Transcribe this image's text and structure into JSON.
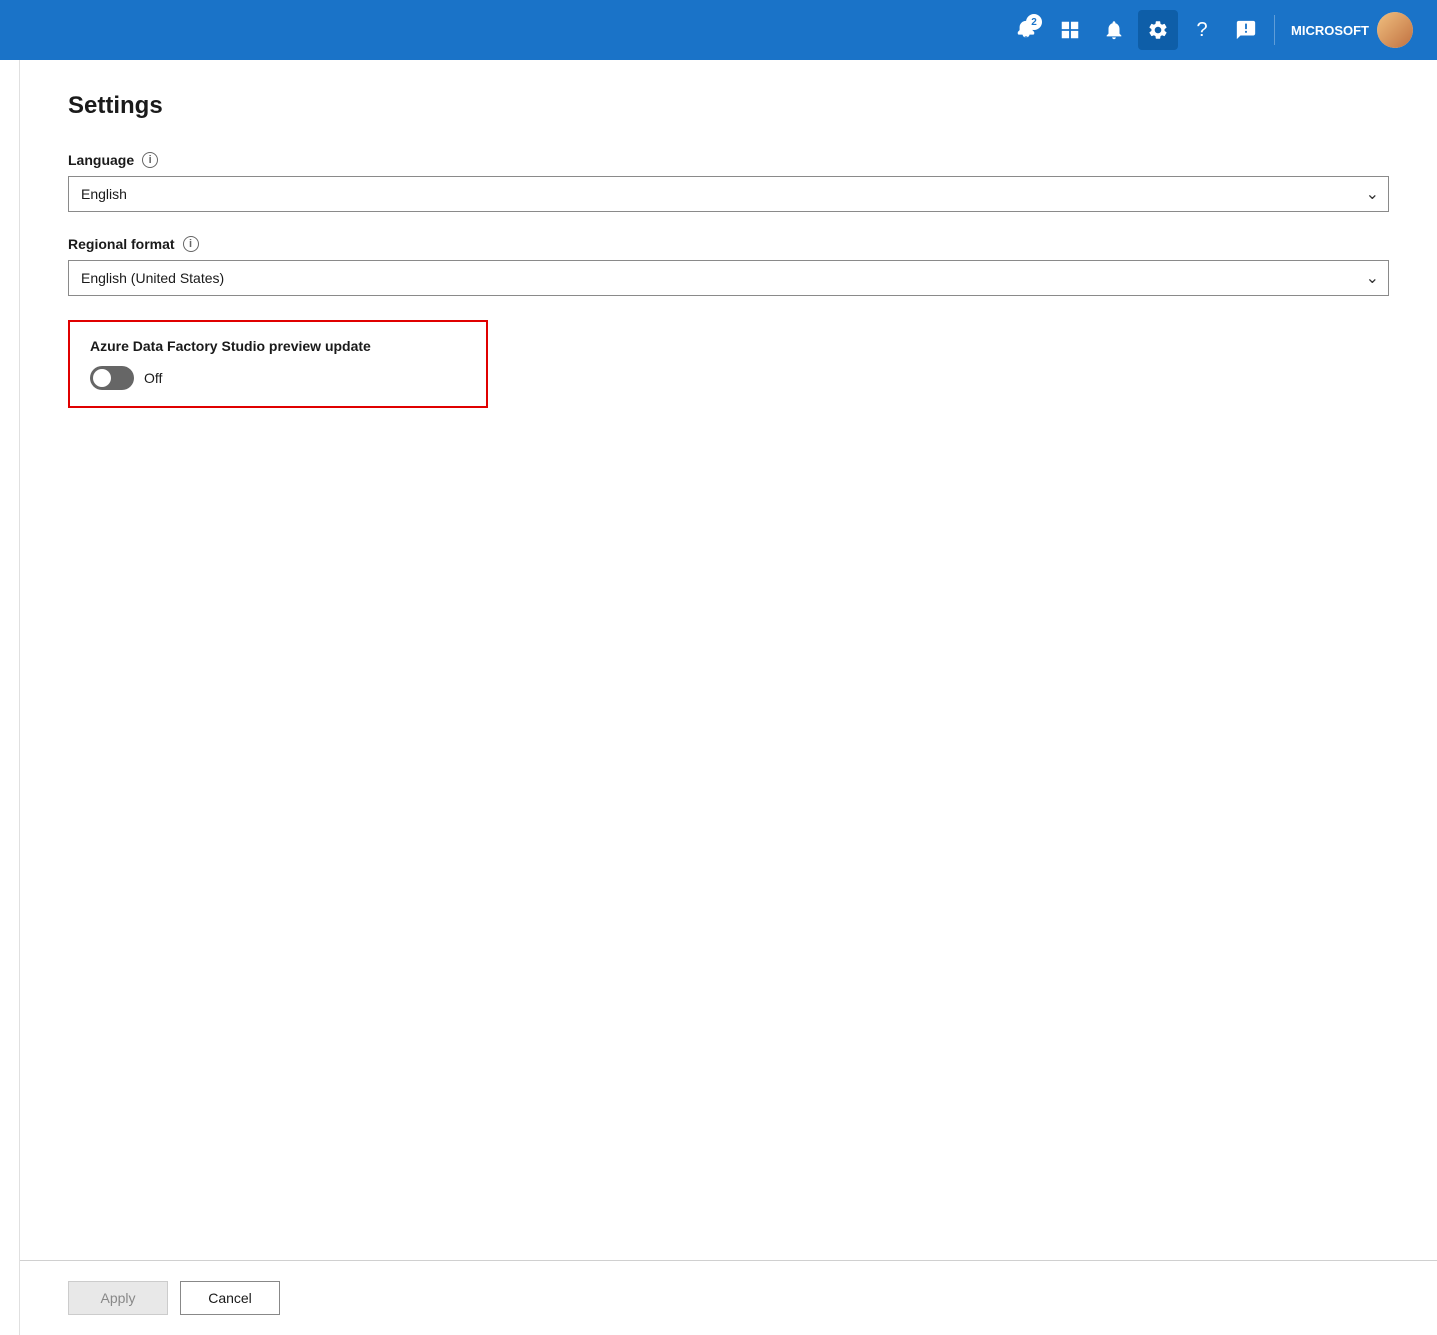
{
  "topbar": {
    "notification_count": "2",
    "user_label": "MICROSOFT",
    "settings_active": true
  },
  "settings": {
    "title": "Settings",
    "language_label": "Language",
    "language_value": "English",
    "regional_format_label": "Regional format",
    "regional_format_value": "English (United States)",
    "preview_section_title": "Azure Data Factory Studio preview update",
    "toggle_state": "Off",
    "apply_button": "Apply",
    "cancel_button": "Cancel"
  }
}
